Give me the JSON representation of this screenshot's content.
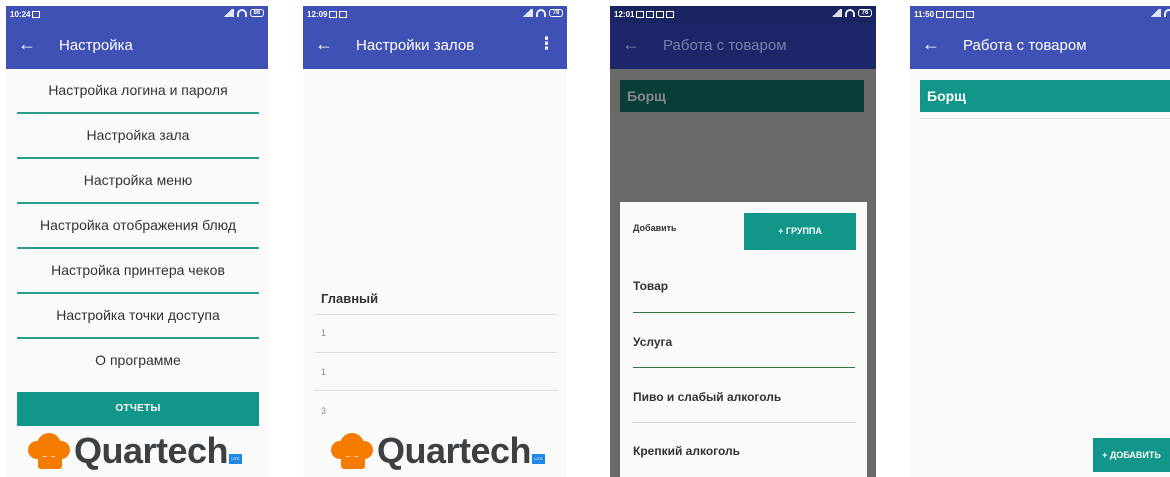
{
  "colors": {
    "primary": "#3f51b5",
    "accent": "#119689",
    "divider": "#2b9d8f",
    "logo_orange": "#f57c00",
    "logo_text": "#3c4043"
  },
  "brand": {
    "name": "Quartech",
    "badge": "LITE"
  },
  "screen1": {
    "status": {
      "time": "10:24",
      "battery": "86"
    },
    "title": "Настройка",
    "back_icon": "arrow-left-icon",
    "menu": [
      "Настройка логина и пароля",
      "Настройка зала",
      "Настройка меню",
      "Настройка отображения блюд",
      "Настройка принтера чеков",
      "Настройка точки доступа",
      "О программе"
    ],
    "reports_button": "ОТЧЕТЫ"
  },
  "screen2": {
    "status": {
      "time": "12:09",
      "battery": "78"
    },
    "title": "Настройки залов",
    "overflow_icon": "more-vertical-icon",
    "hall_name": "Главный",
    "rows": [
      "1",
      "1",
      "3"
    ]
  },
  "screen3": {
    "status": {
      "time": "12:01",
      "battery": "76"
    },
    "title": "Работа с товаром",
    "item": "Борщ",
    "dialog": {
      "add_label": "Добавить",
      "group_button": "+ ГРУППА",
      "options": [
        "Товар",
        "Услуга",
        "Пиво и слабый алкоголь",
        "Крепкий алкоголь"
      ]
    }
  },
  "screen4": {
    "status": {
      "time": "11:50"
    },
    "title": "Работа с товаром",
    "item": "Борщ",
    "add_button": "+ ДОБАВИТЬ"
  }
}
